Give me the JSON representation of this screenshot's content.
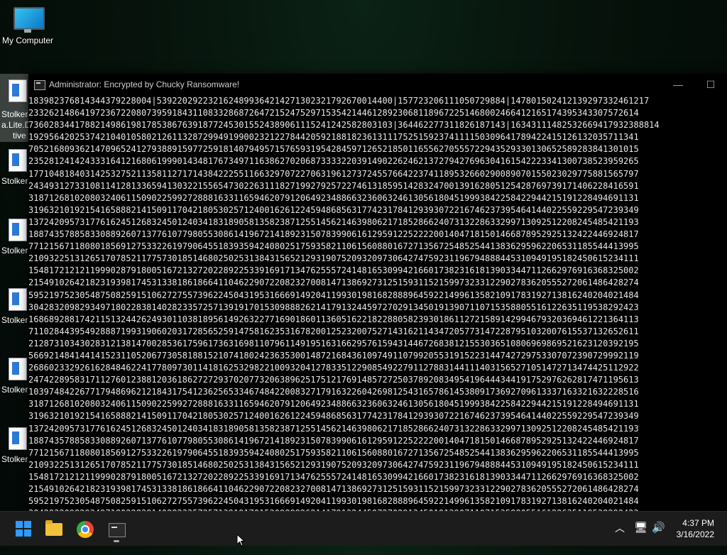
{
  "desktop": {
    "icons": [
      {
        "label": "My Computer",
        "icon": "monitor-icon"
      }
    ],
    "side_icons": [
      {
        "label": "Stolker",
        "icon": "document-icon"
      },
      {
        "label": "Stolker",
        "icon": "document-icon"
      },
      {
        "label": "Stolker",
        "icon": "document-icon"
      },
      {
        "label": "Stolker",
        "icon": "document-icon"
      },
      {
        "label": "Stolker",
        "icon": "document-icon"
      },
      {
        "label": "Stolker",
        "icon": "document-icon"
      }
    ],
    "selected_icon": {
      "line1": "Stolker",
      "line2": "a.Lite.D",
      "line3": "tive"
    }
  },
  "window": {
    "title": "Administrator:  Encrypted by Chucky Ransomware!",
    "minimize": "—",
    "maximize": "☐",
    "console_lines": [
      "183982376814344379228004|5392202922321624899364214271302321792670014400|157723206111050729884|147801502412139297332461217",
      "23326214864197236722080739591843110833286872647215247529715354214461289230681189672251468002466412165174395343307572614",
      "73602834417882149861981785386763918772453015524389061115241242582803103|364462277311826187143|16343111482532669417932388814",
      "19295642025374210401058021261132872994919900232122784420592188182361311175251592374111150309641789422415126132035711341",
      "70521680936214709652412793889159772591814079495715765931954284597126521850116556270555722943529330130652589283841301015",
      "23528124142433316412168061999014348176734971163862702068733332203914902262462137279427696304161542223341300738523959265",
      "17710481840314253275211358112717143842225511663297072270631961273724557664223741189532660290089070155023029775881565797",
      "24349312733108114128133659413032215565473022631118271992792572274613185951428324700139162805125428769739171406228416591",
      "31871268102080324061150902259927288816331165946207912064923488663236063246130561804519993842258422944215191228494691131",
      "31963210192154165888214150911704218053025712400162612245948685631774231784129393072216746237395464144022559229547239349",
      "13724209573177616245126832450124034183189058135823871255145621463980621718528662407313228633299713092512208245485421193",
      "18874357885833088926071377610779805530861419672141892315078399061612959122522220014047181501466878952925132422446924817",
      "77121567118080185691275332261979064551839359424080251759358211061560880167271356725485254413836295962206531185544413995",
      "21093225131265170785211775730185146802502531384315652129319075209320973064274759231196794888445310949195182450615234111",
      "15481721212119990287918005167213272022892253391691713476255572414816530994216601738231618139033447112662976916368325002",
      "21549102642182319398174531338186186641104622907220823270081471386927312515931152159973233122902783620555272061486428274",
      "59521975230548750825915106272755739622450431953166691492041199301981682888964592214996135821091783192713816240204021484",
      "30428320982934971802283814028233572571391917015309888262141791324459727029134501913907110715358805516122635119538292423",
      "16868928817421151324426249301103818956149263227716901860113605162218228805823930186112721589142994679320369461221364113",
      "71102844395492888719931906020317285652591475816235316782001252320075271431621143472057731472287951032007615537132652611",
      "21287310343028312138147002853617596173631698110796114919516316629576159431446726838121553036510806969869521623120392195",
      "56692148414414152311052067730581881521074180242363530014872168436109749110799205531915223144742729753307072390729992119",
      "26860233292616284846224177809730114181625329822100932041278335122908549227911278831441114031565271051472713474425112922",
      "24742289583171127601238812036186272729370207732063896251751217691485727250378920834954196444344191752976262817471195613",
      "10397484226771794869621218431754123625653346748422008327179163226042698125431657861453809173692709613337163321632228516",
      "31871268102080324061150902259927288816331165946207912064923488663236063246130561804519993842258422944215191228494691131",
      "31963210192154165888214150911704218053025712400162612245948685631774231784129393072216746237395464144022559229547239349",
      "13724209573177616245126832450124034183189058135823871255145621463980621718528662407313228633299713092512208245485421193",
      "18874357885833088926071377610779805530861419672141892315078399061612959122522220014047181501466878952925132422446924817",
      "77121567118080185691275332261979064551839359424080251759358211061560880167271356725485254413836295962206531185544413995",
      "21093225131265170785211775730185146802502531384315652129319075209320973064274759231196794888445310949195182450615234111",
      "15481721212119990287918005167213272022892253391691713476255572414816530994216601738231618139033447112662976916368325002",
      "21549102642182319398174531338186186641104622907220823270081471386927312515931152159973233122902783620555272061486428274",
      "59521975230548750825915106272755739622450431953166691492041199301981682888964592214996135821091783192713816240204021484",
      "30428320982934971802283814028233572571391917015309888262141791324459727029134501913907110715358805516122635119538292423",
      "16868928817421151324426249301103818956149263227716901860113605162218228805823930186112721589142994679320369461221364113",
      "71102844395492888719931906020317285652591475816235316782001252320075271431621143472057731472287951032007615537132652611"
    ]
  },
  "taskbar": {
    "items": [
      {
        "name": "start-button",
        "icon": "windows-logo-icon"
      },
      {
        "name": "file-explorer",
        "icon": "folder-icon"
      },
      {
        "name": "chrome",
        "icon": "chrome-icon"
      },
      {
        "name": "console-window",
        "icon": "terminal-icon"
      }
    ],
    "tray": {
      "chevron": "︿",
      "network": "🖥",
      "volume": "🔊"
    },
    "clock": {
      "time": "4:37 PM",
      "date": "3/16/2022"
    }
  }
}
